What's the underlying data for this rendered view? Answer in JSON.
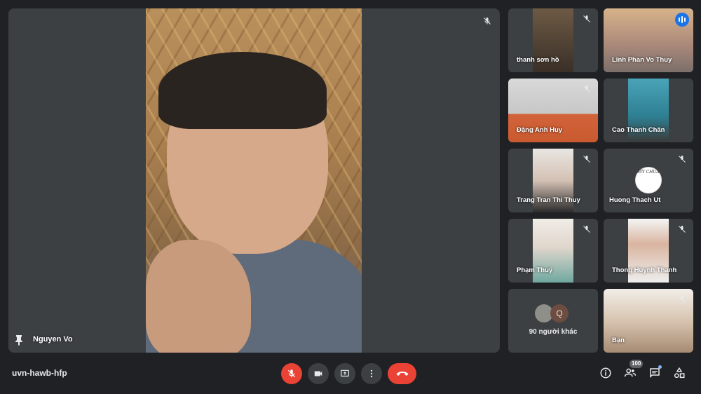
{
  "meeting": {
    "code": "uvn-hawb-hfp"
  },
  "main_speaker": {
    "name": "Nguyen Vo",
    "muted": true
  },
  "participants": [
    {
      "name": "thanh sơn hồ",
      "muted": true
    },
    {
      "name": "Linh Phan Vo Thuy",
      "speaking": true
    },
    {
      "name": "Đặng Anh Huy",
      "muted": true
    },
    {
      "name": "Cao Thanh Chân"
    },
    {
      "name": "Trang Tran Thi Thuy",
      "muted": true
    },
    {
      "name": "Huong Thach Ut",
      "muted": true,
      "avatar_text": "MY CHUA"
    },
    {
      "name": "Phạm Thuý",
      "muted": true
    },
    {
      "name": "Thong Huynh Thanh",
      "muted": true
    },
    {
      "name": "Bạn",
      "muted": true
    }
  ],
  "others": {
    "label": "90 người khác",
    "avatar_letter": "Q"
  },
  "controls": {
    "mic": "mic-off-icon",
    "camera": "videocam-icon",
    "present": "present-screen-icon",
    "more": "more-vert-icon",
    "hangup": "call-end-icon"
  },
  "right_controls": {
    "participants_count": "100"
  },
  "colors": {
    "background": "#202124",
    "tile": "#3c4043",
    "danger": "#ea4335",
    "accent": "#1a73e8"
  }
}
